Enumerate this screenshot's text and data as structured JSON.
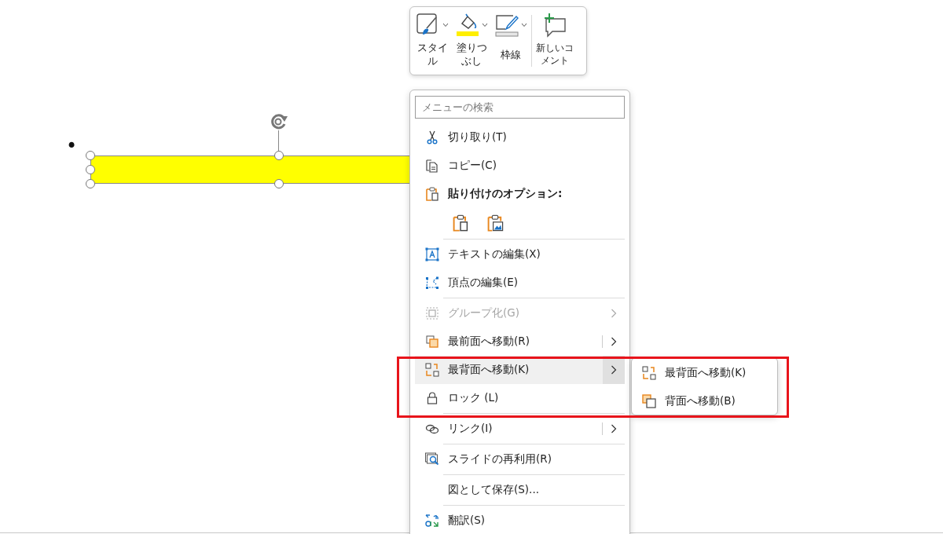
{
  "slide": {
    "bullet": "•"
  },
  "mini_toolbar": {
    "buttons": [
      {
        "label": "スタイル",
        "dropdown": true
      },
      {
        "label": "塗りつぶし",
        "dropdown": true
      },
      {
        "label": "枠線",
        "dropdown": true
      },
      {
        "label": "新しいコメント",
        "dropdown": false
      }
    ]
  },
  "context_menu": {
    "search": {
      "placeholder": "メニューの検索"
    },
    "sections": [
      [
        {
          "kind": "item",
          "label": "切り取り(T)",
          "disabled": false,
          "highlighted": false,
          "submenu": false,
          "split": false
        },
        {
          "kind": "item",
          "label": "コピー(C)",
          "disabled": false,
          "highlighted": false,
          "submenu": false,
          "split": false
        },
        {
          "kind": "heading",
          "label": "貼り付けのオプション:"
        },
        {
          "kind": "paste-buttons"
        }
      ],
      [
        {
          "kind": "item",
          "label": "テキストの編集(X)",
          "disabled": false,
          "highlighted": false,
          "submenu": false,
          "split": false
        },
        {
          "kind": "item",
          "label": "頂点の編集(E)",
          "disabled": false,
          "highlighted": false,
          "submenu": false,
          "split": false
        }
      ],
      [
        {
          "kind": "item",
          "label": "グループ化(G)",
          "disabled": true,
          "highlighted": false,
          "submenu": true,
          "split": false
        },
        {
          "kind": "item",
          "label": "最前面へ移動(R)",
          "disabled": false,
          "highlighted": false,
          "submenu": true,
          "split": true
        },
        {
          "kind": "item",
          "label": "最背面へ移動(K)",
          "disabled": false,
          "highlighted": true,
          "submenu": true,
          "split": false
        },
        {
          "kind": "item",
          "label": "ロック (L)",
          "disabled": false,
          "highlighted": false,
          "submenu": false,
          "split": false
        }
      ],
      [
        {
          "kind": "item",
          "label": "リンク(I)",
          "disabled": false,
          "highlighted": false,
          "submenu": true,
          "split": true
        }
      ],
      [
        {
          "kind": "item",
          "label": "スライドの再利用(R)",
          "disabled": false,
          "highlighted": false,
          "submenu": false,
          "split": false
        }
      ],
      [
        {
          "kind": "item",
          "label": "図として保存(S)...",
          "disabled": false,
          "highlighted": false,
          "submenu": false,
          "split": false
        }
      ],
      [
        {
          "kind": "item",
          "label": "翻訳(S)",
          "disabled": false,
          "highlighted": false,
          "submenu": false,
          "split": false
        }
      ]
    ]
  },
  "submenu": {
    "items": [
      {
        "label": "最背面へ移動(K)"
      },
      {
        "label": "背面へ移動(B)"
      }
    ]
  }
}
